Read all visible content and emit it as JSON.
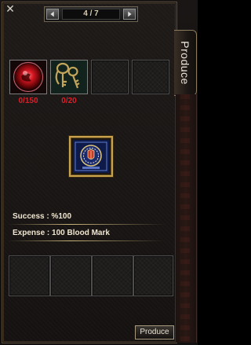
{
  "window": {
    "close_glyph": "✕"
  },
  "pager": {
    "label": "4 / 7"
  },
  "tab": {
    "label": "Produce"
  },
  "materials": [
    {
      "name": "red-orb",
      "quantity": "0/150"
    },
    {
      "name": "keys",
      "quantity": "0/20"
    },
    {
      "name": "empty",
      "quantity": ""
    },
    {
      "name": "empty",
      "quantity": ""
    }
  ],
  "result": {
    "icon": "emblem-card-icon"
  },
  "info": {
    "success": "Success : %100",
    "expense": "Expense : 100 Blood Mark"
  },
  "output_slots": [
    "",
    "",
    "",
    ""
  ],
  "produce_button": "Produce",
  "colors": {
    "quantity_red": "#d8202a",
    "gold_border": "#c9a24b",
    "text_light": "#f0e6d0"
  }
}
